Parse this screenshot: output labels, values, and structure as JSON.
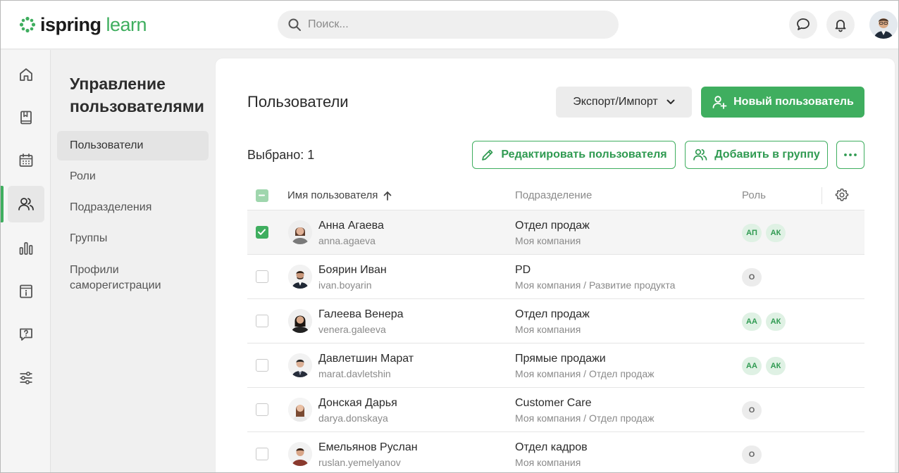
{
  "brand": {
    "name_part1": "ispring",
    "name_part2": "learn",
    "accent": "#3fae5f"
  },
  "search": {
    "placeholder": "Поиск..."
  },
  "rail": [
    {
      "icon": "home-icon"
    },
    {
      "icon": "book-icon"
    },
    {
      "icon": "calendar-icon"
    },
    {
      "icon": "users-icon",
      "active": true
    },
    {
      "icon": "bar-chart-icon"
    },
    {
      "icon": "info-icon"
    },
    {
      "icon": "help-chat-icon"
    },
    {
      "icon": "sliders-icon"
    }
  ],
  "subnav": {
    "title": "Управление пользователями",
    "items": [
      {
        "label": "Пользователи",
        "active": true
      },
      {
        "label": "Роли"
      },
      {
        "label": "Подразделения"
      },
      {
        "label": "Группы"
      },
      {
        "label": "Профили саморегистрации"
      }
    ]
  },
  "page": {
    "title": "Пользователи",
    "export_label": "Экспорт/Импорт",
    "new_user_label": "Новый пользователь",
    "selected_label": "Выбрано: 1",
    "edit_label": "Редактировать пользователя",
    "add_group_label": "Добавить в группу"
  },
  "table": {
    "columns": {
      "name": "Имя пользователя",
      "department": "Подразделение",
      "role": "Роль"
    },
    "rows": [
      {
        "name": "Анна Агаева",
        "login": "anna.agaeva",
        "department": "Отдел продаж",
        "path": "Моя компания",
        "roles": [
          "АП",
          "АК"
        ],
        "checked": true
      },
      {
        "name": "Боярин Иван",
        "login": "ivan.boyarin",
        "department": "PD",
        "path": "Моя компания / Развитие продукта",
        "roles": [
          "О"
        ],
        "checked": false
      },
      {
        "name": "Галеева Венера",
        "login": "venera.galeeva",
        "department": "Отдел продаж",
        "path": "Моя компания",
        "roles": [
          "АА",
          "АК"
        ],
        "checked": false
      },
      {
        "name": "Давлетшин Марат",
        "login": "marat.davletshin",
        "department": "Прямые продажи",
        "path": "Моя компания / Отдел продаж",
        "roles": [
          "АА",
          "АК"
        ],
        "checked": false
      },
      {
        "name": "Донская Дарья",
        "login": "darya.donskaya",
        "department": "Customer Care",
        "path": "Моя компания / Отдел продаж",
        "roles": [
          "О"
        ],
        "checked": false
      },
      {
        "name": "Емельянов Руслан",
        "login": "ruslan.yemelyanov",
        "department": "Отдел кадров",
        "path": "Моя компания",
        "roles": [
          "О"
        ],
        "checked": false
      }
    ]
  }
}
